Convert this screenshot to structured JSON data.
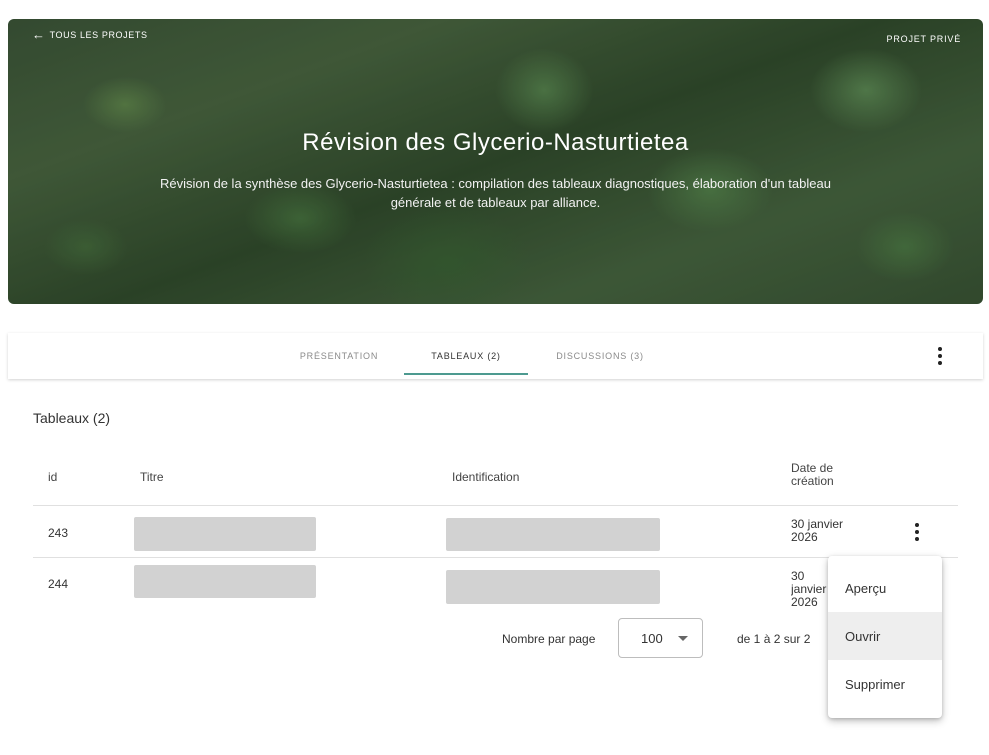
{
  "banner": {
    "back_label": "TOUS LES PROJETS",
    "privacy_label": "PROJET PRIVÉ",
    "title": "Révision des Glycerio-Nasturtietea",
    "description": "Révision de la synthèse des Glycerio-Nasturtietea : compilation des tableaux diagnostiques, élaboration d'un tableau générale et de tableaux par alliance."
  },
  "tabs": [
    {
      "label": "PRÉSENTATION",
      "active": false
    },
    {
      "label": "TABLEAUX (2)",
      "active": true
    },
    {
      "label": "DISCUSSIONS (3)",
      "active": false
    }
  ],
  "section": {
    "title": "Tableaux (2)"
  },
  "table": {
    "headers": {
      "id": "id",
      "titre": "Titre",
      "identification": "Identification",
      "date": "Date de création"
    },
    "rows": [
      {
        "id": "243",
        "date": "30 janvier 2026"
      },
      {
        "id": "244",
        "date": "30 janvier 2026"
      }
    ]
  },
  "pagination": {
    "per_page_label": "Nombre par page",
    "per_page_value": "100",
    "range_text": "de 1 à 2 sur 2"
  },
  "context_menu": {
    "items": [
      "Aperçu",
      "Ouvrir",
      "Supprimer"
    ]
  }
}
